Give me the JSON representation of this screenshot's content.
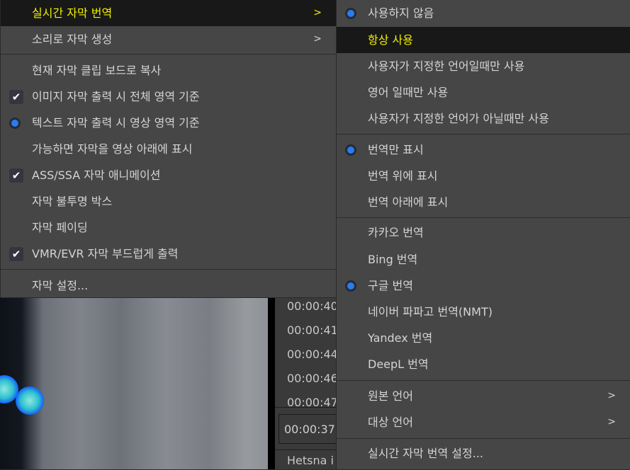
{
  "video_panel": {
    "timestamps": [
      "00:00:40",
      "00:00:41",
      "00:00:44",
      "00:00:46",
      "00:00:47"
    ],
    "time_input": "00:00:37.",
    "subtitle_text": "Hetsna i"
  },
  "left_menu": {
    "items": [
      {
        "label": "실시간 자막 번역",
        "submenu": true,
        "highlighted": true
      },
      {
        "label": "소리로 자막 생성",
        "submenu": true
      },
      {
        "label": "현재 자막 클립 보드로 복사"
      },
      {
        "label": "이미지 자막 출력 시 전체 영역 기준",
        "mark": "check"
      },
      {
        "label": "텍스트 자막 출력 시 영상 영역 기준",
        "mark": "radio"
      },
      {
        "label": "가능하면 자막을 영상 아래에 표시"
      },
      {
        "label": "ASS/SSA 자막 애니메이션",
        "mark": "check"
      },
      {
        "label": "자막 불투명 박스"
      },
      {
        "label": "자막 페이딩"
      },
      {
        "label": "VMR/EVR 자막 부드럽게 출력",
        "mark": "check"
      },
      {
        "label": "자막 설정..."
      }
    ],
    "submenu_arrow": ">"
  },
  "right_menu": {
    "items": [
      {
        "label": "사용하지 않음",
        "mark": "radio"
      },
      {
        "label": "항상 사용",
        "highlighted": true
      },
      {
        "label": "사용자가 지정한 언어일때만 사용"
      },
      {
        "label": "영어 일때만 사용"
      },
      {
        "label": "사용자가 지정한 언어가 아닐때만 사용"
      },
      {
        "label": "번역만 표시",
        "mark": "radio"
      },
      {
        "label": "번역 위에 표시"
      },
      {
        "label": "번역 아래에 표시"
      },
      {
        "label": "카카오 번역"
      },
      {
        "label": "Bing 번역"
      },
      {
        "label": "구글 번역",
        "mark": "radio"
      },
      {
        "label": "네이버 파파고 번역(NMT)"
      },
      {
        "label": "Yandex 번역"
      },
      {
        "label": "DeepL 번역"
      },
      {
        "label": "원본 언어",
        "submenu": true
      },
      {
        "label": "대상 언어",
        "submenu": true
      },
      {
        "label": "실시간 자막 번역 설정..."
      }
    ],
    "submenu_arrow": ">"
  },
  "colors": {
    "highlight_text": "#f0f000",
    "radio": "#2a7cf0",
    "menu_bg": "#464646"
  }
}
